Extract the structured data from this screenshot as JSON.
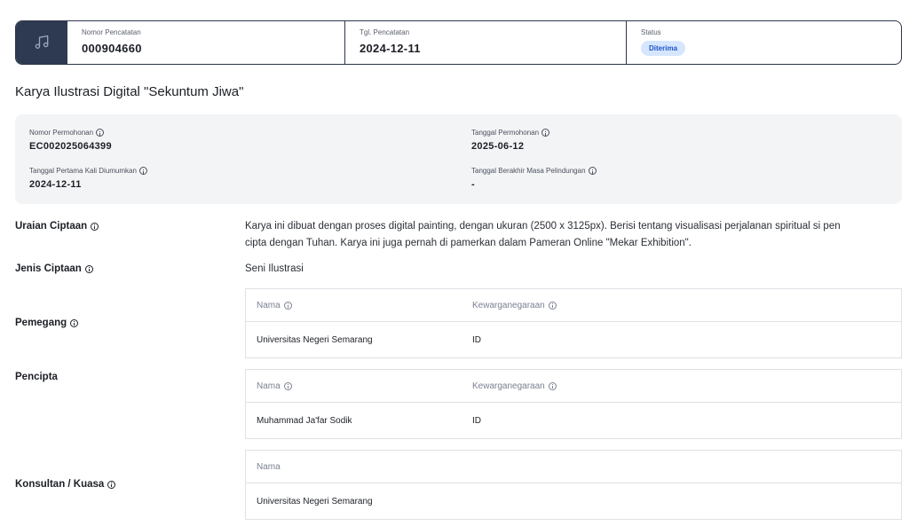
{
  "header": {
    "icon": "music-note-icon",
    "nomor_label": "Nomor Pencatatan",
    "nomor_value": "000904660",
    "tgl_label": "Tgl. Pencatatan",
    "tgl_value": "2024-12-11",
    "status_label": "Status",
    "status_value": "Diterima",
    "accent": "#2e3a52",
    "badge_color": "#d6e6ff"
  },
  "title": "Karya Ilustrasi Digital \"Sekuntum Jiwa\"",
  "summary": {
    "nomor_permohonan_label": "Nomor Permohonan",
    "nomor_permohonan_value": "EC002025064399",
    "tanggal_permohonan_label": "Tanggal Permohonan",
    "tanggal_permohonan_value": "2025-06-12",
    "tanggal_umum_label": "Tanggal Pertama Kali Diumumkan",
    "tanggal_umum_value": "2024-12-11",
    "tanggal_berakhir_label": "Tanggal Berakhir Masa Pelindungan",
    "tanggal_berakhir_value": "-"
  },
  "uraian": {
    "label": "Uraian Ciptaan",
    "line1": "Karya ini dibuat dengan proses digital painting, dengan ukuran (2500 x 3125px). Berisi tentang visualisasi perjalanan spiritual si pen",
    "line2": "cipta dengan Tuhan. Karya ini juga pernah di pamerkan dalam Pameran Online \"Mekar Exhibition\"."
  },
  "jenis": {
    "label": "Jenis Ciptaan",
    "value": "Seni Ilustrasi"
  },
  "pemegang": {
    "label": "Pemegang",
    "col_nama": "Nama",
    "col_kewarganegaraan": "Kewarganegaraan",
    "rows": [
      {
        "nama": "Universitas Negeri Semarang",
        "kewarganegaraan": "ID"
      }
    ]
  },
  "pencipta": {
    "label": "Pencipta",
    "col_nama": "Nama",
    "col_kewarganegaraan": "Kewarganegaraan",
    "rows": [
      {
        "nama": "Muhammad Ja'far Sodik",
        "kewarganegaraan": "ID"
      }
    ]
  },
  "konsultan": {
    "label": "Konsultan / Kuasa",
    "col_nama": "Nama",
    "rows": [
      {
        "nama": "Universitas Negeri Semarang"
      }
    ]
  }
}
